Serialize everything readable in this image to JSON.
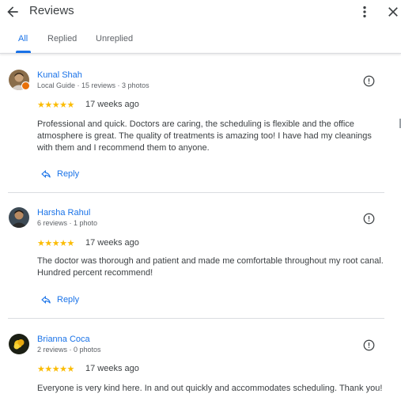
{
  "header": {
    "title": "Reviews",
    "icons": [
      "arrow-back-icon",
      "more-vert-icon",
      "close-icon"
    ]
  },
  "tabs": [
    {
      "label": "All",
      "active": true
    },
    {
      "label": "Replied",
      "active": false
    },
    {
      "label": "Unreplied",
      "active": false
    }
  ],
  "colors": {
    "accent": "#1a73e8",
    "star": "#fbbc04",
    "text": "#3c4043",
    "secondary": "#5f6368",
    "local_guide_badge": "#e8710a"
  },
  "reviews": [
    {
      "name": "Kunal Shah",
      "meta": "Local Guide · 15 reviews · 3 photos",
      "stars": "★★★★★",
      "rating": 5,
      "time": "17 weeks ago",
      "text": "Professional and quick. Doctors are caring, the scheduling is flexible and the office atmosphere is great. The quality of treatments is amazing too! I have had my cleanings with them and I recommend them to anyone.",
      "reply_label": "Reply"
    },
    {
      "name": "Harsha Rahul",
      "meta": "6 reviews · 1 photo",
      "stars": "★★★★★",
      "rating": 5,
      "time": "17 weeks ago",
      "text": "The doctor was thorough and patient and made me comfortable throughout my root canal. Hundred percent recommend!",
      "reply_label": "Reply"
    },
    {
      "name": "Brianna Coca",
      "meta": "2 reviews · 0 photos",
      "stars": "★★★★★",
      "rating": 5,
      "time": "17 weeks ago",
      "text": "Everyone is very kind here. In and out quickly and accommodates scheduling. Thank you!"
    }
  ]
}
